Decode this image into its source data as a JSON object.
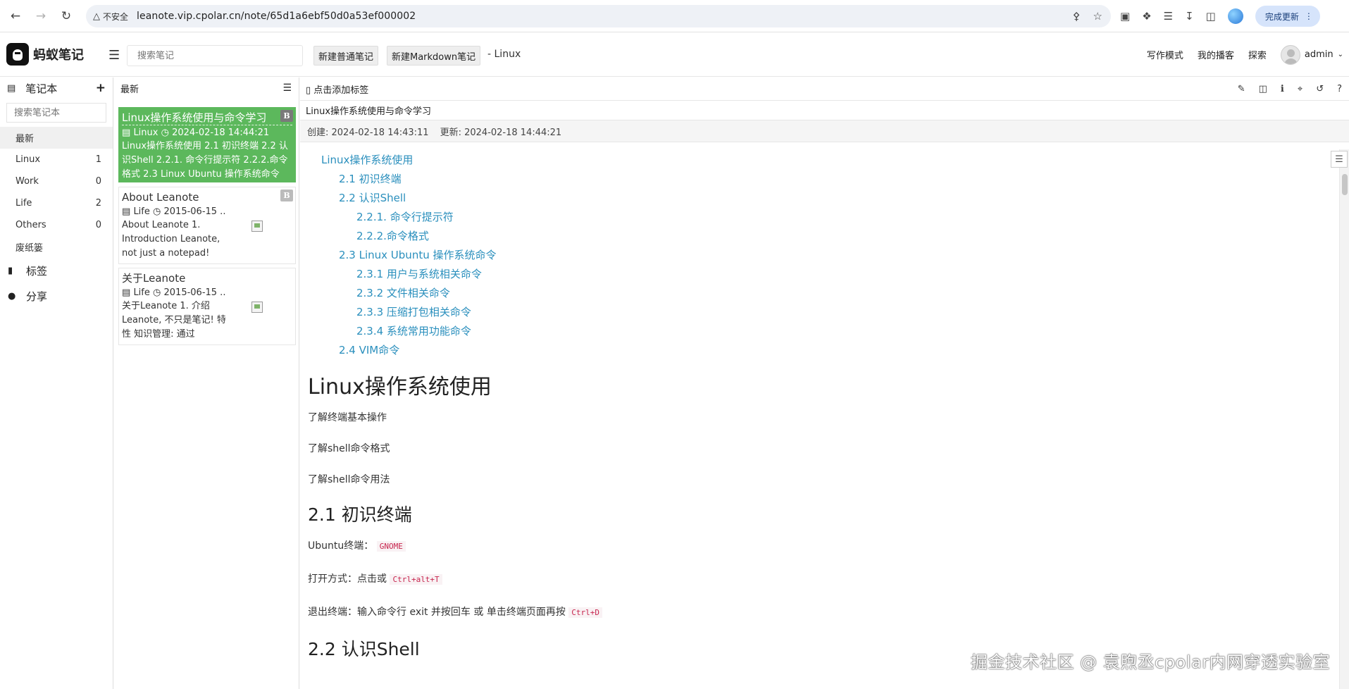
{
  "browser": {
    "insecure_label": "不安全",
    "url": "leanote.vip.cpolar.cn/note/65d1a6ebf50d0a53ef000002",
    "update_label": "完成更新"
  },
  "header": {
    "app_name": "蚂蚁笔记",
    "search_placeholder": "搜索笔记",
    "new_note_label": "新建普通笔记",
    "new_md_label": "新建Markdown笔记",
    "current_notebook": "- Linux",
    "nav": [
      "写作模式",
      "我的播客",
      "探索"
    ],
    "username": "admin"
  },
  "sidebar": {
    "title": "笔记本",
    "search_placeholder": "搜索笔记本",
    "items": [
      {
        "label": "最新",
        "count": ""
      },
      {
        "label": "Linux",
        "count": "1"
      },
      {
        "label": "Work",
        "count": "0"
      },
      {
        "label": "Life",
        "count": "2"
      },
      {
        "label": "Others",
        "count": "0"
      },
      {
        "label": "废纸篓",
        "count": ""
      }
    ],
    "tags_label": "标签",
    "share_label": "分享"
  },
  "note_list": {
    "title": "最新",
    "notes": [
      {
        "title": "Linux操作系统使用与命令学习",
        "badge": "B",
        "notebook": "Linux",
        "time": "2024-02-18 14:44:21",
        "desc": "Linux操作系统使用 2.1 初识终端 2.2 认识Shell 2.2.1. 命令行提示符 2.2.2.命令格式 2.3 Linux Ubuntu 操作系统命令"
      },
      {
        "title": "About Leanote",
        "badge": "B",
        "notebook": "Life",
        "time": "2015-06-15 ..",
        "desc": "About Leanote 1. Introduction Leanote, not just a notepad!"
      },
      {
        "title": "关于Leanote",
        "notebook": "Life",
        "time": "2015-06-15 ..",
        "desc": "关于Leanote 1. 介绍 Leanote, 不只是笔记! 特性 知识管理: 通过"
      }
    ]
  },
  "editor": {
    "add_tag_label": "点击添加标签",
    "title": "Linux操作系统使用与命令学习",
    "created": "创建: 2024-02-18 14:43:11",
    "updated": "更新: 2024-02-18 14:44:21",
    "toc": [
      {
        "level": 1,
        "text": "Linux操作系统使用"
      },
      {
        "level": 2,
        "text": "2.1 初识终端"
      },
      {
        "level": 2,
        "text": "2.2 认识Shell"
      },
      {
        "level": 3,
        "text": "2.2.1. 命令行提示符"
      },
      {
        "level": 3,
        "text": "2.2.2.命令格式"
      },
      {
        "level": 2,
        "text": "2.3 Linux Ubuntu 操作系统命令"
      },
      {
        "level": 3,
        "text": "2.3.1 用户与系统相关命令"
      },
      {
        "level": 3,
        "text": "2.3.2 文件相关命令"
      },
      {
        "level": 3,
        "text": "2.3.3 压缩打包相关命令"
      },
      {
        "level": 3,
        "text": "2.3.4 系统常用功能命令"
      },
      {
        "level": 2,
        "text": "2.4 VIM命令"
      }
    ],
    "h1": "Linux操作系统使用",
    "intro": [
      "了解终端基本操作",
      "了解shell命令格式",
      "了解shell命令用法"
    ],
    "h2_terminal": "2.1 初识终端",
    "ubuntu_label": "Ubuntu终端：",
    "ubuntu_code": "GNOME",
    "open_label": "打开方式：点击或",
    "open_code": "Ctrl+alt+T",
    "exit_label": "退出终端：输入命令行 exit 并按回车 或 单击终端页面再按",
    "exit_code": "Ctrl+D",
    "h2_shell": "2.2 认识Shell"
  },
  "watermark": "掘金技术社区 @ 袁煦丞cpolar内网穿透实验室"
}
